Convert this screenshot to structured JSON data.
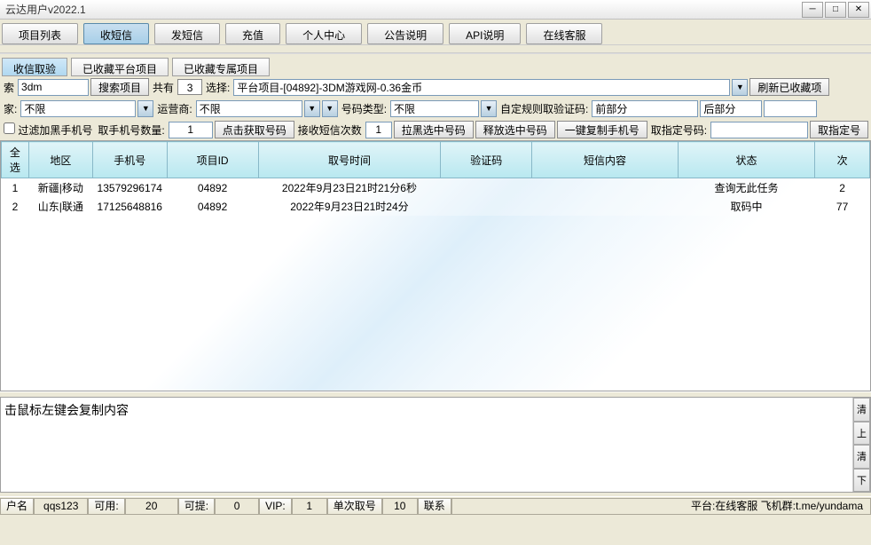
{
  "window": {
    "title": "云达用户v2022.1",
    "minimize": "─",
    "maximize": "□",
    "close": "×"
  },
  "main_tabs": [
    "项目列表",
    "收短信",
    "发短信",
    "充值",
    "个人中心",
    "公告说明",
    "API说明",
    "在线客服"
  ],
  "sub_tabs": [
    "收信取验",
    "已收藏平台项目",
    "已收藏专属项目"
  ],
  "search_row": {
    "search_label": "索",
    "search_value": "3dm",
    "search_btn": "搜索项目",
    "total_label": "共有",
    "total_count": "3",
    "select_label": "选择:",
    "project_text": "平台项目-[04892]-3DM游戏网-0.36金币",
    "refresh_btn": "刷新已收藏项"
  },
  "filter_row": {
    "home_label": "家:",
    "home_value": "不限",
    "operator_label": "运营商:",
    "operator_value": "不限",
    "num_type_label": "号码类型:",
    "num_type_value": "不限",
    "custom_rule_label": "自定规则取验证码:",
    "custom_rule_value": "前部分",
    "back_part": "后部分"
  },
  "action_row": {
    "filter_black_label": "过滤加黑手机号",
    "get_count_label": "取手机号数量:",
    "get_count_value": "1",
    "get_num_btn": "点击获取号码",
    "recv_count_label": "接收短信次数",
    "recv_count_value": "1",
    "blacklist_btn": "拉黑选中号码",
    "release_btn": "释放选中号码",
    "copy_all_btn": "一键复制手机号",
    "get_specific_label": "取指定号码:",
    "get_specific_btn": "取指定号"
  },
  "table": {
    "columns": [
      "全选",
      "地区",
      "手机号",
      "项目ID",
      "取号时间",
      "验证码",
      "短信内容",
      "状态",
      "次"
    ],
    "rows": [
      {
        "idx": "1",
        "region": "新疆|移动",
        "phone": "13579296174",
        "pid": "04892",
        "time": "2022年9月23日21时21分6秒",
        "code": "",
        "msg": "",
        "status": "查询无此任务",
        "count": "2"
      },
      {
        "idx": "2",
        "region": "山东|联通",
        "phone": "17125648816",
        "pid": "04892",
        "time": "2022年9月23日21时24分",
        "code": "",
        "msg": "",
        "status": "取码中",
        "count": "77"
      }
    ]
  },
  "lower": {
    "hint": "击鼠标左键会复制内容",
    "side": [
      "清",
      "上",
      "清",
      "下"
    ]
  },
  "status": {
    "user_label": "户名",
    "user_value": "qqs123",
    "avail_label": "可用:",
    "avail_value": "20",
    "get_label": "可提:",
    "get_value": "0",
    "vip_label": "VIP:",
    "vip_value": "1",
    "single_label": "单次取号",
    "single_value": "10",
    "contact_label": "联系",
    "platform_info": "平台:在线客服  飞机群:t.me/yundama"
  }
}
